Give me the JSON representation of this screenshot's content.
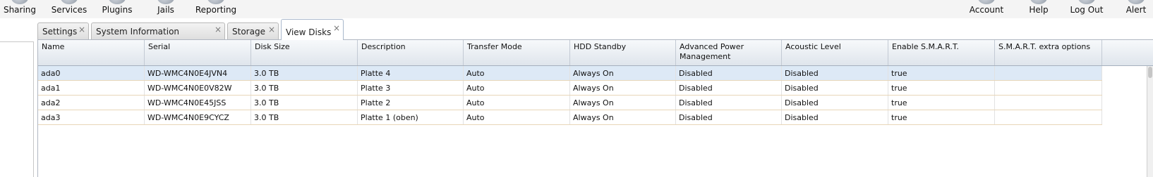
{
  "toolbar": {
    "items": [
      {
        "label": "Sharing",
        "icon": "sharing-icon"
      },
      {
        "label": "Services",
        "icon": "services-icon"
      },
      {
        "label": "Plugins",
        "icon": "plugins-icon"
      },
      {
        "label": "Jails",
        "icon": "jails-icon"
      },
      {
        "label": "Reporting",
        "icon": "reporting-icon"
      },
      {
        "label": "Account",
        "icon": "account-icon"
      },
      {
        "label": "Help",
        "icon": "help-icon"
      },
      {
        "label": "Log Out",
        "icon": "logout-icon"
      },
      {
        "label": "Alert",
        "icon": "alert-icon"
      }
    ]
  },
  "tabs": [
    {
      "label": "Settings",
      "close": "×"
    },
    {
      "label": "System Information",
      "close": "×"
    },
    {
      "label": "Storage",
      "close": "×"
    },
    {
      "label": "View Disks",
      "close": "×",
      "active": true
    }
  ],
  "grid": {
    "columns": [
      "Name",
      "Serial",
      "Disk Size",
      "Description",
      "Transfer Mode",
      "HDD Standby",
      "Advanced Power Management",
      "Acoustic Level",
      "Enable S.M.A.R.T.",
      "S.M.A.R.T. extra options"
    ],
    "rows": [
      [
        "ada0",
        "WD-WMC4N0E4JVN4",
        "3.0 TB",
        "Platte 4",
        "Auto",
        "Always On",
        "Disabled",
        "Disabled",
        "true",
        ""
      ],
      [
        "ada1",
        "WD-WMC4N0E0V82W",
        "3.0 TB",
        "Platte 3",
        "Auto",
        "Always On",
        "Disabled",
        "Disabled",
        "true",
        ""
      ],
      [
        "ada2",
        "WD-WMC4N0E45JSS",
        "3.0 TB",
        "Platte 2",
        "Auto",
        "Always On",
        "Disabled",
        "Disabled",
        "true",
        ""
      ],
      [
        "ada3",
        "WD-WMC4N0E9CYCZ",
        "3.0 TB",
        "Platte 1 (oben)",
        "Auto",
        "Always On",
        "Disabled",
        "Disabled",
        "true",
        ""
      ]
    ],
    "selected_row": 0
  },
  "colors": {
    "selected_row": "#dde9f6",
    "row_divider": "#e8d6b8",
    "header_gradient_bottom": "#dfe5ec"
  }
}
